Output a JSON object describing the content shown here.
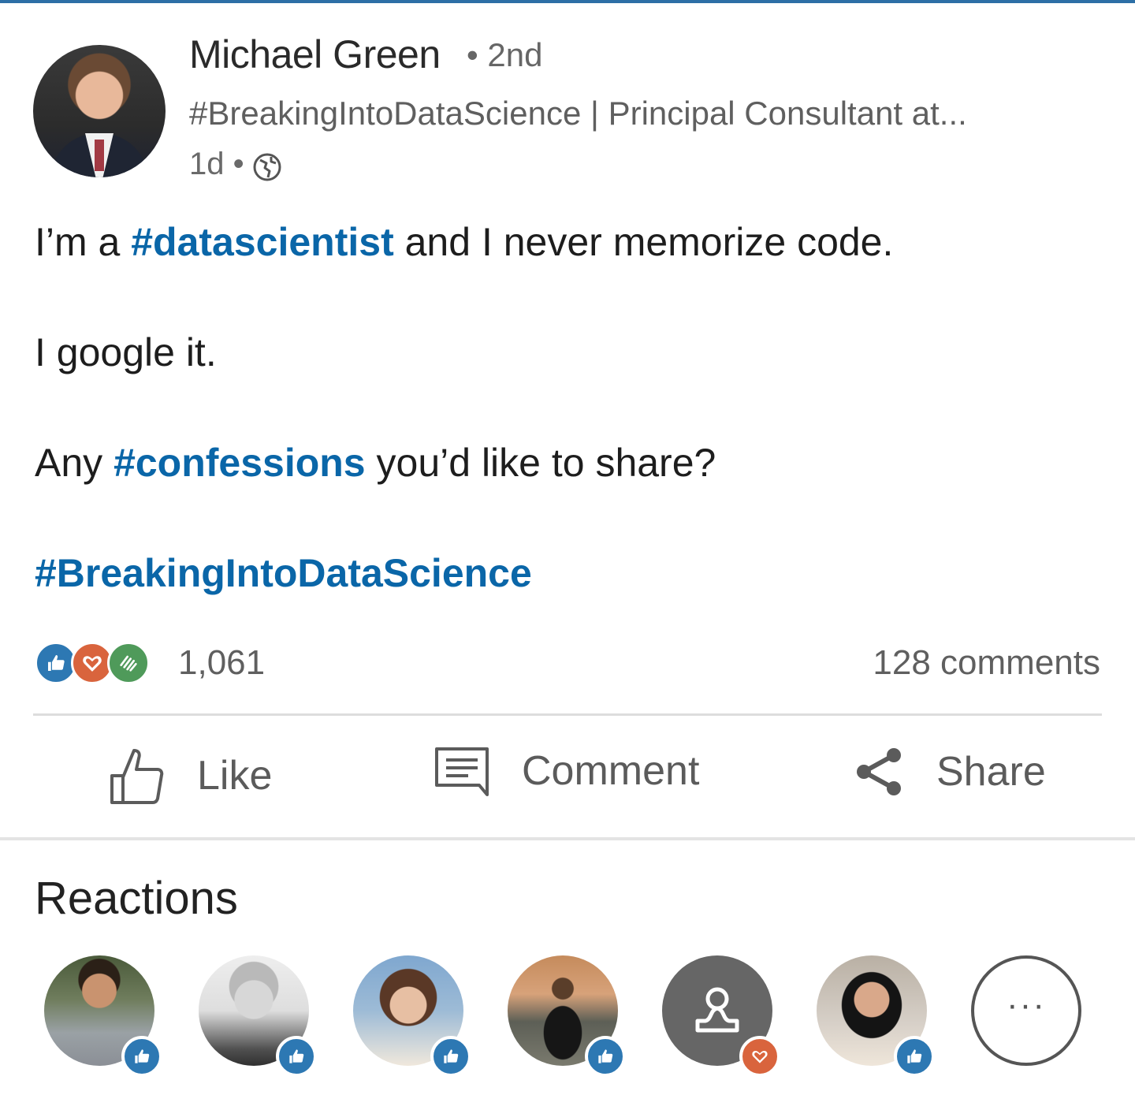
{
  "author": {
    "name": "Michael Green",
    "degree": "• 2nd",
    "headline": "#BreakingIntoDataScience | Principal Consultant at...",
    "age": "1d •",
    "visibility_icon": "globe-icon"
  },
  "post": {
    "line1": {
      "before": "I’m a ",
      "tag": "#datascientist",
      "after": " and I never memorize code."
    },
    "line2": "I google it.",
    "line3": {
      "before": "Any ",
      "tag": "#confessions",
      "after": " you’d like to share?"
    },
    "line4_tag": "#BreakingIntoDataScience"
  },
  "social": {
    "reaction_icons": [
      "like-icon",
      "love-icon",
      "celebrate-icon"
    ],
    "reaction_count": "1,061",
    "comments": "128 comments"
  },
  "actions": {
    "like": "Like",
    "comment": "Comment",
    "share": "Share"
  },
  "reactions_section": {
    "title": "Reactions",
    "reactors": [
      {
        "reaction": "like"
      },
      {
        "reaction": "like"
      },
      {
        "reaction": "like"
      },
      {
        "reaction": "like"
      },
      {
        "reaction": "love"
      },
      {
        "reaction": "like"
      }
    ],
    "more_label": "···"
  },
  "colors": {
    "hashtag": "#0a66a8",
    "like_blue": "#2d78b3",
    "love_orange": "#d9643d",
    "celebrate_green": "#4f9a5a"
  }
}
